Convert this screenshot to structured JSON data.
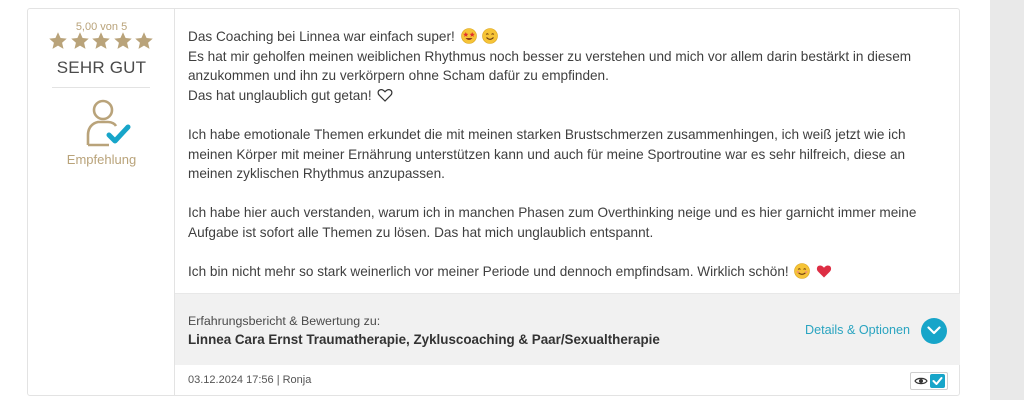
{
  "rating": {
    "score_text": "5,00 von 5",
    "stars": 5,
    "grade": "SEHR GUT",
    "recommendation_label": "Empfehlung"
  },
  "review": {
    "p1_l1": "Das Coaching bei Linnea war einfach super!",
    "p1_l2": "Es hat mir geholfen meinen weiblichen Rhythmus noch besser zu verstehen und mich vor allem darin bestärkt in diesem",
    "p1_l3": "anzukommen und ihn zu verkörpern ohne Scham dafür zu empfinden.",
    "p1_l4": "Das hat unglaublich gut getan!",
    "p2": "Ich habe emotionale Themen erkundet die mit meinen starken Brustschmerzen zusammenhingen, ich weiß jetzt wie ich meinen Körper mit meiner Ernährung unterstützen kann und auch für meine Sportroutine war es sehr hilfreich, diese an meinen zyklischen Rhythmus anzupassen.",
    "p3": "Ich habe hier auch verstanden, warum ich in manchen Phasen zum Overthinking neige und es hier garnicht immer meine Aufgabe ist sofort alle Themen zu lösen. Das hat mich unglaublich entspannt.",
    "p4": "Ich bin nicht mehr so stark weinerlich vor meiner Periode und dennoch empfindsam. Wirklich schön!"
  },
  "subject": {
    "label": "Erfahrungsbericht & Bewertung zu:",
    "name": "Linnea Cara Ernst Traumatherapie, Zykluscoaching & Paar/Sexualtherapie",
    "details_link": "Details & Optionen"
  },
  "meta": {
    "date_author": "03.12.2024 17:56 | Ronja"
  },
  "colors": {
    "gold": "#b9a37a",
    "accent": "#17a5c9"
  }
}
